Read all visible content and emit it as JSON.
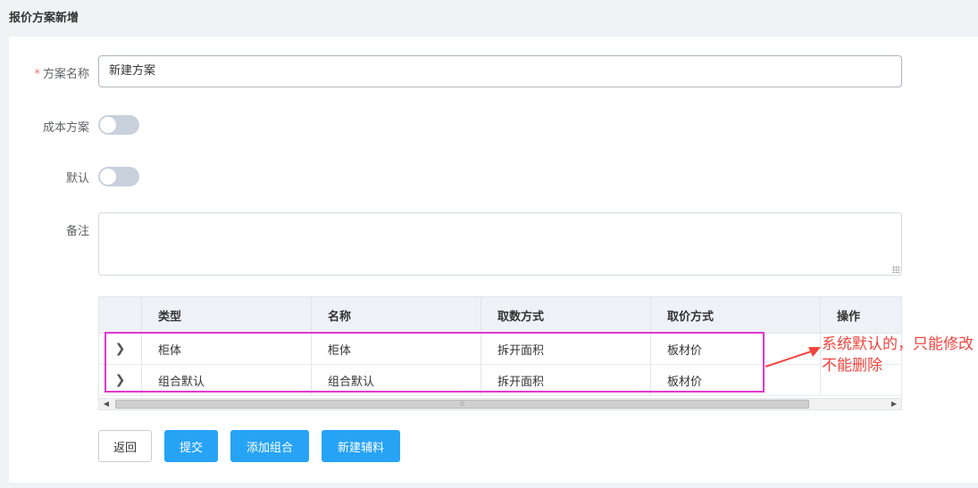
{
  "page": {
    "title": "报价方案新增"
  },
  "form": {
    "name": {
      "label": "方案名称",
      "required_mark": "*",
      "value": "新建方案"
    },
    "cost_plan": {
      "label": "成本方案",
      "on": false
    },
    "default": {
      "label": "默认",
      "on": false
    },
    "remark": {
      "label": "备注",
      "value": ""
    }
  },
  "table": {
    "columns": [
      "类型",
      "名称",
      "取数方式",
      "取价方式",
      "操作"
    ],
    "rows": [
      {
        "type": "柜体",
        "name": "柜体",
        "fetch_method": "拆开面积",
        "price_method": "板材价"
      },
      {
        "type": "组合默认",
        "name": "组合默认",
        "fetch_method": "拆开面积",
        "price_method": "板材价"
      }
    ],
    "scroll_grip": "⦙⦙⦙"
  },
  "annotation": {
    "text": "系统默认的，只能修改不能删除",
    "color": "#f2453f",
    "border_color": "#e238d0"
  },
  "buttons": {
    "back": "返回",
    "submit": "提交",
    "add_group": "添加组合",
    "new_material": "新建辅料"
  },
  "colors": {
    "primary": "#27a3f5",
    "switch_off": "#c8d0dc"
  }
}
